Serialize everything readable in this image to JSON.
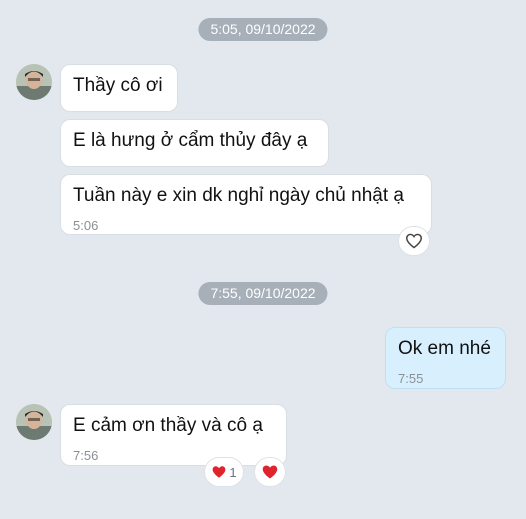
{
  "chat": {
    "divider_1": "5:05, 09/10/2022",
    "divider_2": "7:55, 09/10/2022",
    "messages": [
      {
        "text": "Thầy cô ơi"
      },
      {
        "text": "E là hưng ở cẩm thủy đây ạ"
      },
      {
        "text": "Tuần này e xin dk nghỉ ngày chủ nhật ạ",
        "time": "5:06"
      },
      {
        "text": "Ok em nhé",
        "time": "7:55"
      },
      {
        "text": "E cảm ơn thầy và cô ạ",
        "time": "7:56"
      }
    ],
    "reaction_count": "1"
  },
  "icons": {
    "avatar": "user-avatar",
    "react_empty": "heart-outline-icon",
    "react_filled": "heart-filled-icon"
  },
  "colors": {
    "background": "#e3e8ef",
    "time_pill": "#a7afb9",
    "sent_bubble": "#d8f0fd",
    "heart": "#e0242e"
  }
}
